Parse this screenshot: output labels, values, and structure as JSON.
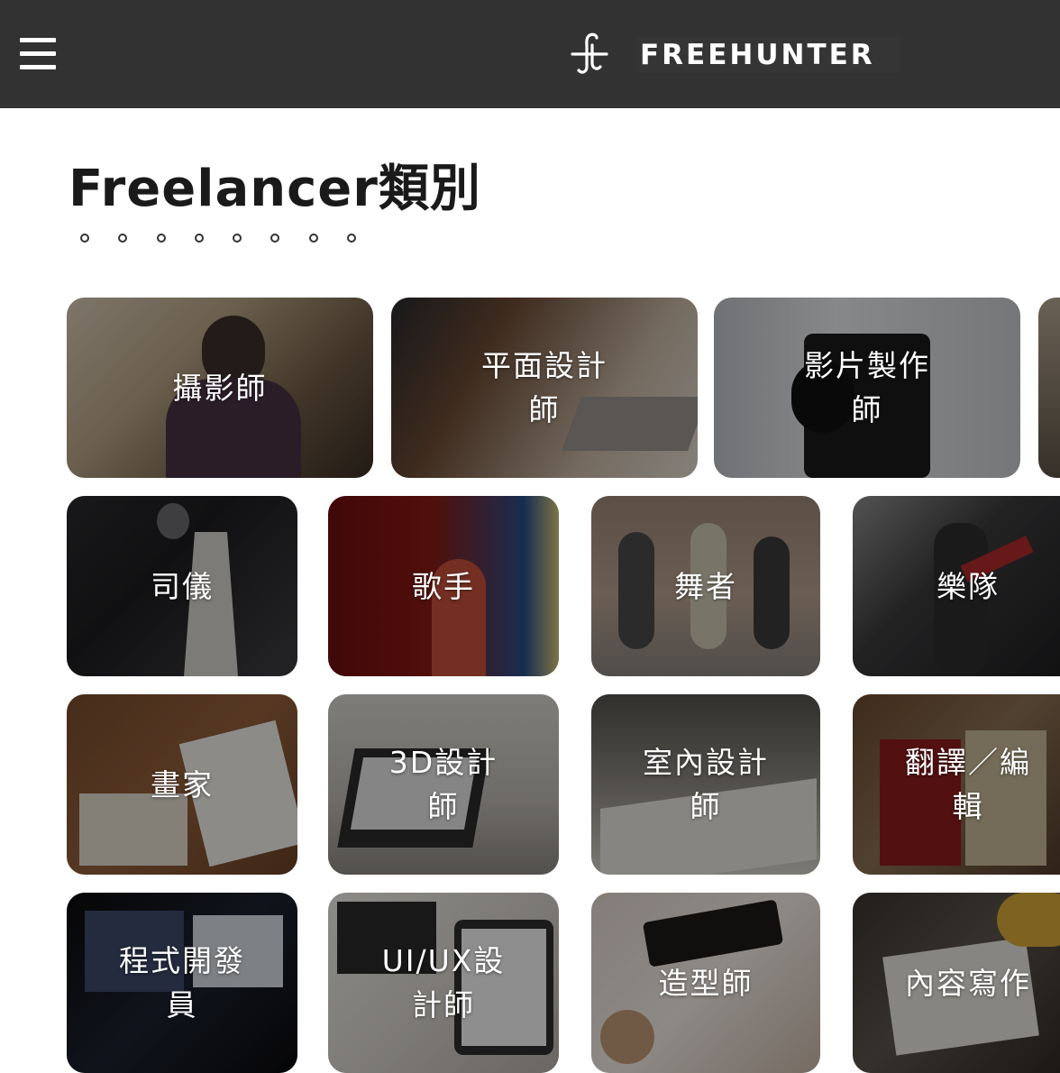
{
  "header": {
    "brand": "FREEHUNTER",
    "logo_icon": "freehunter-logo-icon",
    "menu_icon": "hamburger-menu-icon",
    "background": "#323232"
  },
  "page": {
    "title": "Freelancer類別",
    "carousel_dots": 8
  },
  "categories": [
    {
      "label": "攝影師"
    },
    {
      "label": "平面設計師"
    },
    {
      "label": "影片製作師"
    },
    {
      "label": "司儀"
    },
    {
      "label": "歌手"
    },
    {
      "label": "舞者"
    },
    {
      "label": "樂隊"
    },
    {
      "label": "畫家"
    },
    {
      "label": "3D設計師"
    },
    {
      "label": "室內設計師"
    },
    {
      "label": "翻譯／編輯"
    },
    {
      "label": "程式開發員"
    },
    {
      "label": "UI/UX設計師"
    },
    {
      "label": "造型師"
    },
    {
      "label": "內容寫作"
    }
  ]
}
